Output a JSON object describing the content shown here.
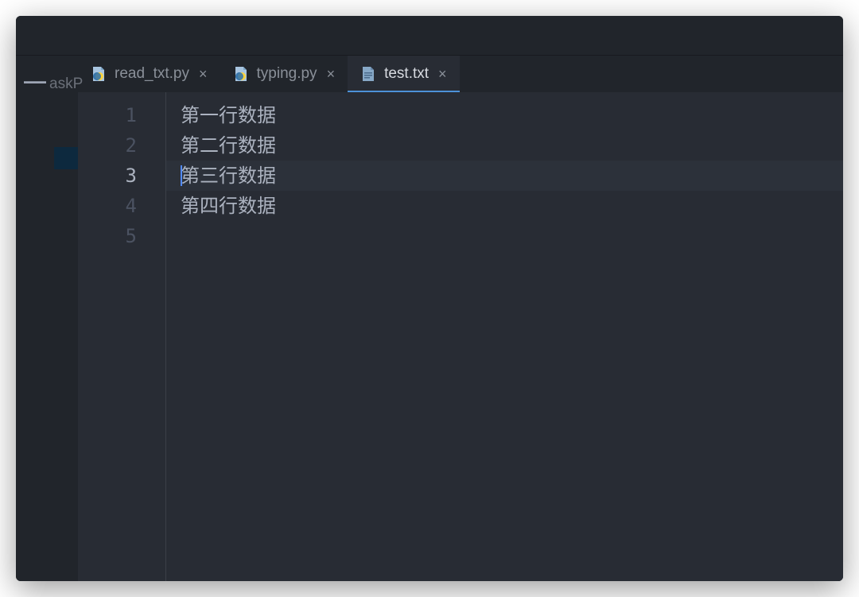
{
  "sidebar": {
    "panel_text": "askP"
  },
  "tabs": [
    {
      "label": "read_txt.py",
      "type": "python",
      "active": false
    },
    {
      "label": "typing.py",
      "type": "python",
      "active": false
    },
    {
      "label": "test.txt",
      "type": "text",
      "active": true
    }
  ],
  "editor": {
    "lines": [
      "第一行数据",
      "第二行数据",
      "第三行数据",
      "第四行数据",
      ""
    ],
    "current_line": 3,
    "line_numbers": [
      "1",
      "2",
      "3",
      "4",
      "5"
    ]
  }
}
